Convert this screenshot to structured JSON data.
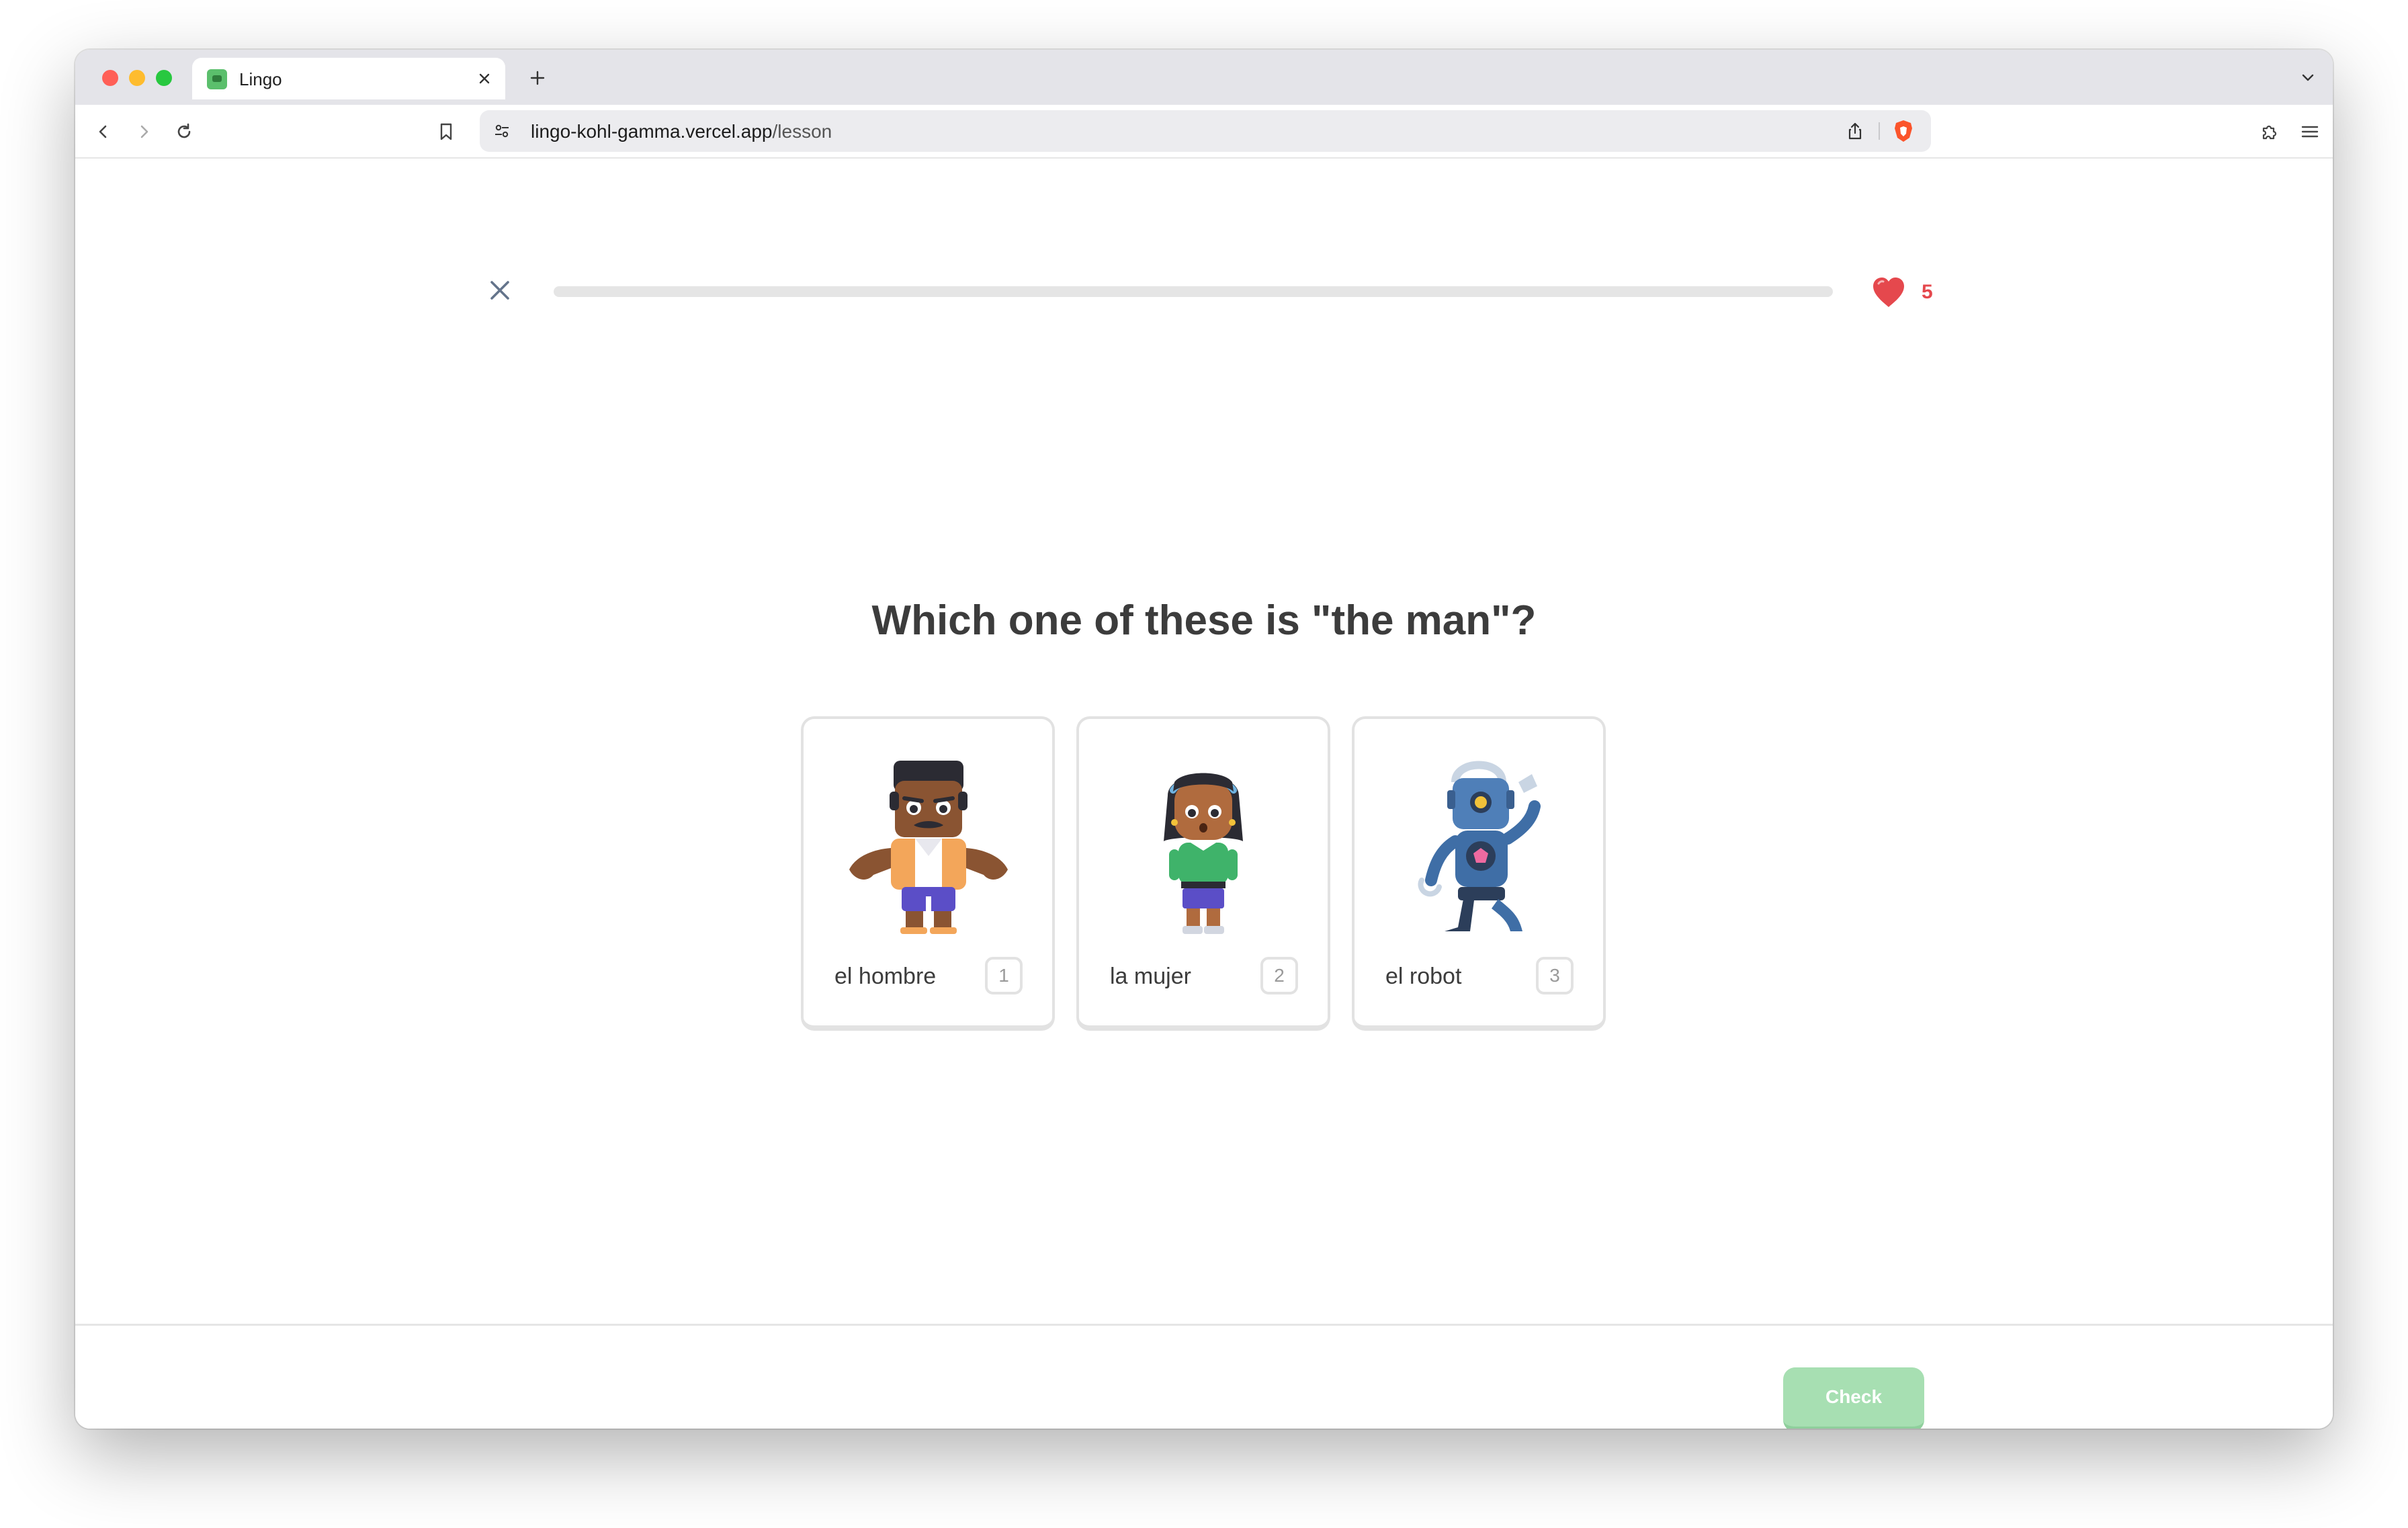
{
  "browser": {
    "tab_title": "Lingo",
    "url_domain": "lingo-kohl-gamma.vercel.app",
    "url_path": "/lesson",
    "icons": {
      "back": "chevron-left-icon",
      "forward": "chevron-right-icon",
      "reload": "reload-icon",
      "bookmark": "bookmark-icon",
      "site_settings": "tune-icon",
      "share": "share-icon",
      "brave": "brave-shield-icon",
      "extensions": "puzzle-icon",
      "menu": "hamburger-icon"
    }
  },
  "lesson": {
    "progress_percent": 0,
    "hearts": "5",
    "question": "Which one of these is \"the man\"?",
    "options": [
      {
        "label": "el hombre",
        "key": "1",
        "illustration": "man-character"
      },
      {
        "label": "la mujer",
        "key": "2",
        "illustration": "woman-character"
      },
      {
        "label": "el robot",
        "key": "3",
        "illustration": "robot-character"
      }
    ],
    "check_label": "Check"
  },
  "colors": {
    "heart": "#e5484d",
    "check_disabled": "#a7dfb2",
    "progress_track": "#e5e5e5",
    "text": "#3c3c3c"
  }
}
